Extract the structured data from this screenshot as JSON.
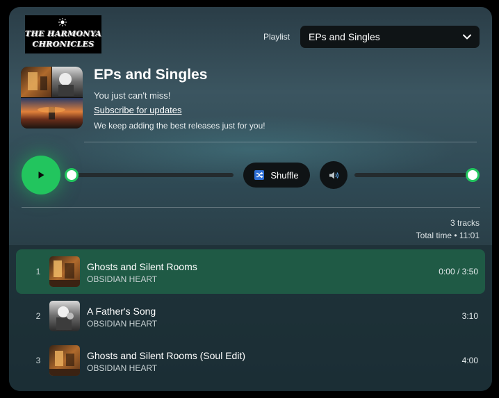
{
  "logo": {
    "line1": "THE HARMONYA",
    "line2": "CHRONICLES",
    "icon": "sun-icon"
  },
  "playlist_selector": {
    "label": "Playlist",
    "value": "EPs and Singles"
  },
  "header": {
    "title": "EPs and Singles",
    "subtitle": "You just can't miss!",
    "subscribe_link": "Subscribe for updates",
    "tagline": "We keep adding the best releases just for you!"
  },
  "player": {
    "play_icon": "play-icon",
    "progress": 0,
    "shuffle_label": "Shuffle",
    "shuffle_icon": "shuffle-icon",
    "volume_icon": "volume-icon",
    "volume": 1
  },
  "stats": {
    "track_count": "3 tracks",
    "total_time": "Total time • 11:01"
  },
  "tracks": [
    {
      "number": "1",
      "title": "Ghosts and Silent Rooms",
      "artist": "OBSIDIAN HEART",
      "duration": "0:00 / 3:50",
      "active": true
    },
    {
      "number": "2",
      "title": "A Father's Song",
      "artist": "OBSIDIAN HEART",
      "duration": "3:10",
      "active": false
    },
    {
      "number": "3",
      "title": "Ghosts and Silent Rooms (Soul Edit)",
      "artist": "OBSIDIAN HEART",
      "duration": "4:00",
      "active": false
    }
  ],
  "colors": {
    "accent": "#22c55e",
    "active_row": "#1f5a45",
    "control_bg": "#0f1315"
  }
}
